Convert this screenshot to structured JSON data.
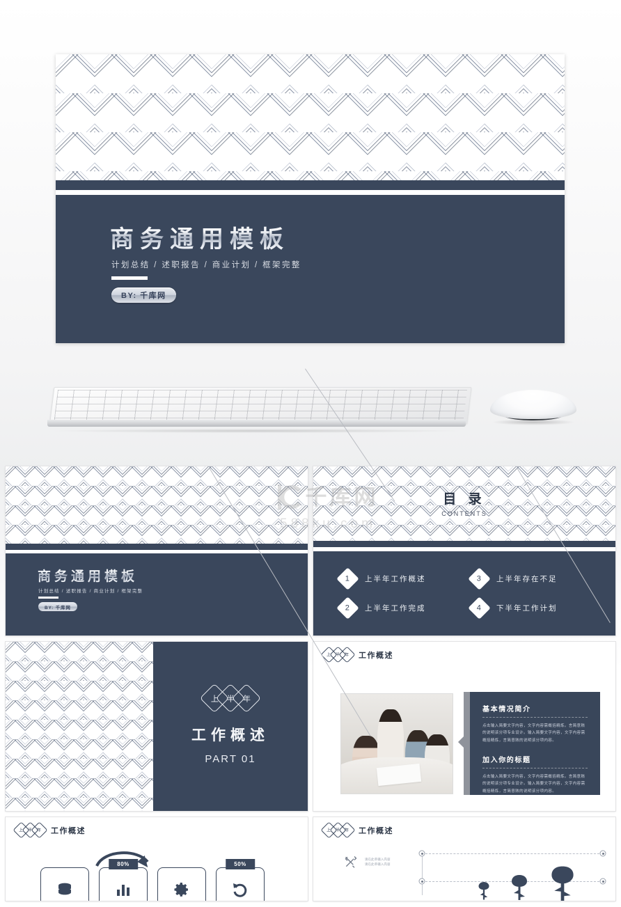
{
  "hero": {
    "title": "商务通用模板",
    "subtitle": "计划总结 / 述职报告 / 商业计划 / 框架完整",
    "badge": "BY:  千库网"
  },
  "devices": {
    "keyboard_name": "keyboard-mockup",
    "mouse_name": "mouse-mockup"
  },
  "watermark": {
    "logo": "qianku-logo",
    "text": "千库网",
    "domain": "588ku.com"
  },
  "thumbnails": {
    "title_slide": {
      "title": "商务通用模板",
      "subtitle": "计划总结 / 述职报告 / 商业计划 / 框架完整",
      "badge": "BY:  千库网"
    },
    "contents_slide": {
      "heading_cn": "目 录",
      "heading_en": "CONTENTS",
      "items": [
        {
          "num": "1",
          "label": "上半年工作概述"
        },
        {
          "num": "3",
          "label": "上半年存在不足"
        },
        {
          "num": "2",
          "label": "上半年工作完成"
        },
        {
          "num": "4",
          "label": "下半年工作计划"
        }
      ]
    },
    "section_slide": {
      "diamonds": [
        "上",
        "半",
        "年"
      ],
      "title": "工作概述",
      "part": "PART 01"
    },
    "overview_slide": {
      "header_diamonds": [
        "上",
        "半",
        "年"
      ],
      "header_title": "工作概述",
      "photo_alt": "team-meeting-photo",
      "blocks": [
        {
          "title": "基本情况简介",
          "body": "点击输入简要文字内容，文字内容需概括精炼。言简意赅的说明该分项专业设计。输入简要文字内容，文字内容需概括精炼，言简意赅的说明该分项内容。"
        },
        {
          "title": "加入你的标题",
          "body": "点击输入简要文字内容，文字内容需概括精炼。言简意赅的说明该分项专业设计。输入简要文字内容，文字内容需概括精炼，言简意赅的说明该分项内容。"
        }
      ]
    },
    "process_slide": {
      "header_diamonds": [
        "上",
        "半",
        "年"
      ],
      "header_title": "工作概述",
      "cards": [
        {
          "icon": "database-icon",
          "badge": ""
        },
        {
          "icon": "bar-chart-icon",
          "badge": "80%"
        },
        {
          "icon": "gear-icon",
          "badge": ""
        },
        {
          "icon": "undo-arrow-icon",
          "badge": "50%"
        }
      ]
    },
    "timeline_slide": {
      "header_diamonds": [
        "上",
        "半",
        "年"
      ],
      "header_title": "工作概述",
      "entries": [
        {
          "icon": "tools-icon",
          "line1": "请在此单输入内容",
          "line2": "请在此单输入内容"
        }
      ],
      "trees_icon": "tree-icon"
    }
  },
  "colors": {
    "navy": "#3a475c",
    "navy_dark": "#2b3545",
    "panel": "#39465a",
    "panel_edge": "#8f939b",
    "text_light": "#eef1f5",
    "page_bg": "#f4f4f5"
  }
}
